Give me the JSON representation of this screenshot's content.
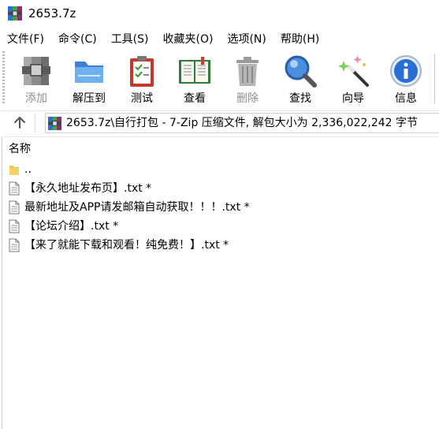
{
  "window": {
    "title": "2653.7z",
    "app_icon": "7zip-archive-icon"
  },
  "menu": {
    "items": [
      "文件(F)",
      "命令(C)",
      "工具(S)",
      "收藏夹(O)",
      "选项(N)",
      "帮助(H)"
    ]
  },
  "toolbar": {
    "buttons": [
      {
        "label": "添加",
        "icon": "add-archive-icon",
        "enabled": false
      },
      {
        "label": "解压到",
        "icon": "extract-folder-icon",
        "enabled": true
      },
      {
        "label": "测试",
        "icon": "test-clipboard-icon",
        "enabled": true
      },
      {
        "label": "查看",
        "icon": "view-book-icon",
        "enabled": true
      },
      {
        "label": "删除",
        "icon": "delete-trash-icon",
        "enabled": false
      },
      {
        "label": "查找",
        "icon": "find-magnifier-icon",
        "enabled": true
      },
      {
        "label": "向导",
        "icon": "wizard-wand-icon",
        "enabled": true
      },
      {
        "label": "信息",
        "icon": "info-icon",
        "enabled": true
      }
    ]
  },
  "address": {
    "up_icon": "up-arrow-icon",
    "path_text": "2653.7z\\自行打包 - 7-Zip 压缩文件, 解包大小为 2,336,022,242 字节"
  },
  "file_list": {
    "column_name": "名称",
    "rows": [
      {
        "name": "..",
        "icon": "folder-icon"
      },
      {
        "name": "【永久地址发布页】.txt *",
        "icon": "text-file-icon"
      },
      {
        "name": "最新地址及APP请发邮箱自动获取！！！.txt *",
        "icon": "text-file-icon"
      },
      {
        "name": "【论坛介绍】.txt *",
        "icon": "text-file-icon"
      },
      {
        "name": "【来了就能下载和观看！纯免费！】.txt *",
        "icon": "text-file-icon"
      }
    ]
  },
  "colors": {
    "disabled_text": "#8f8f8f",
    "folder": "#f2c24a"
  }
}
